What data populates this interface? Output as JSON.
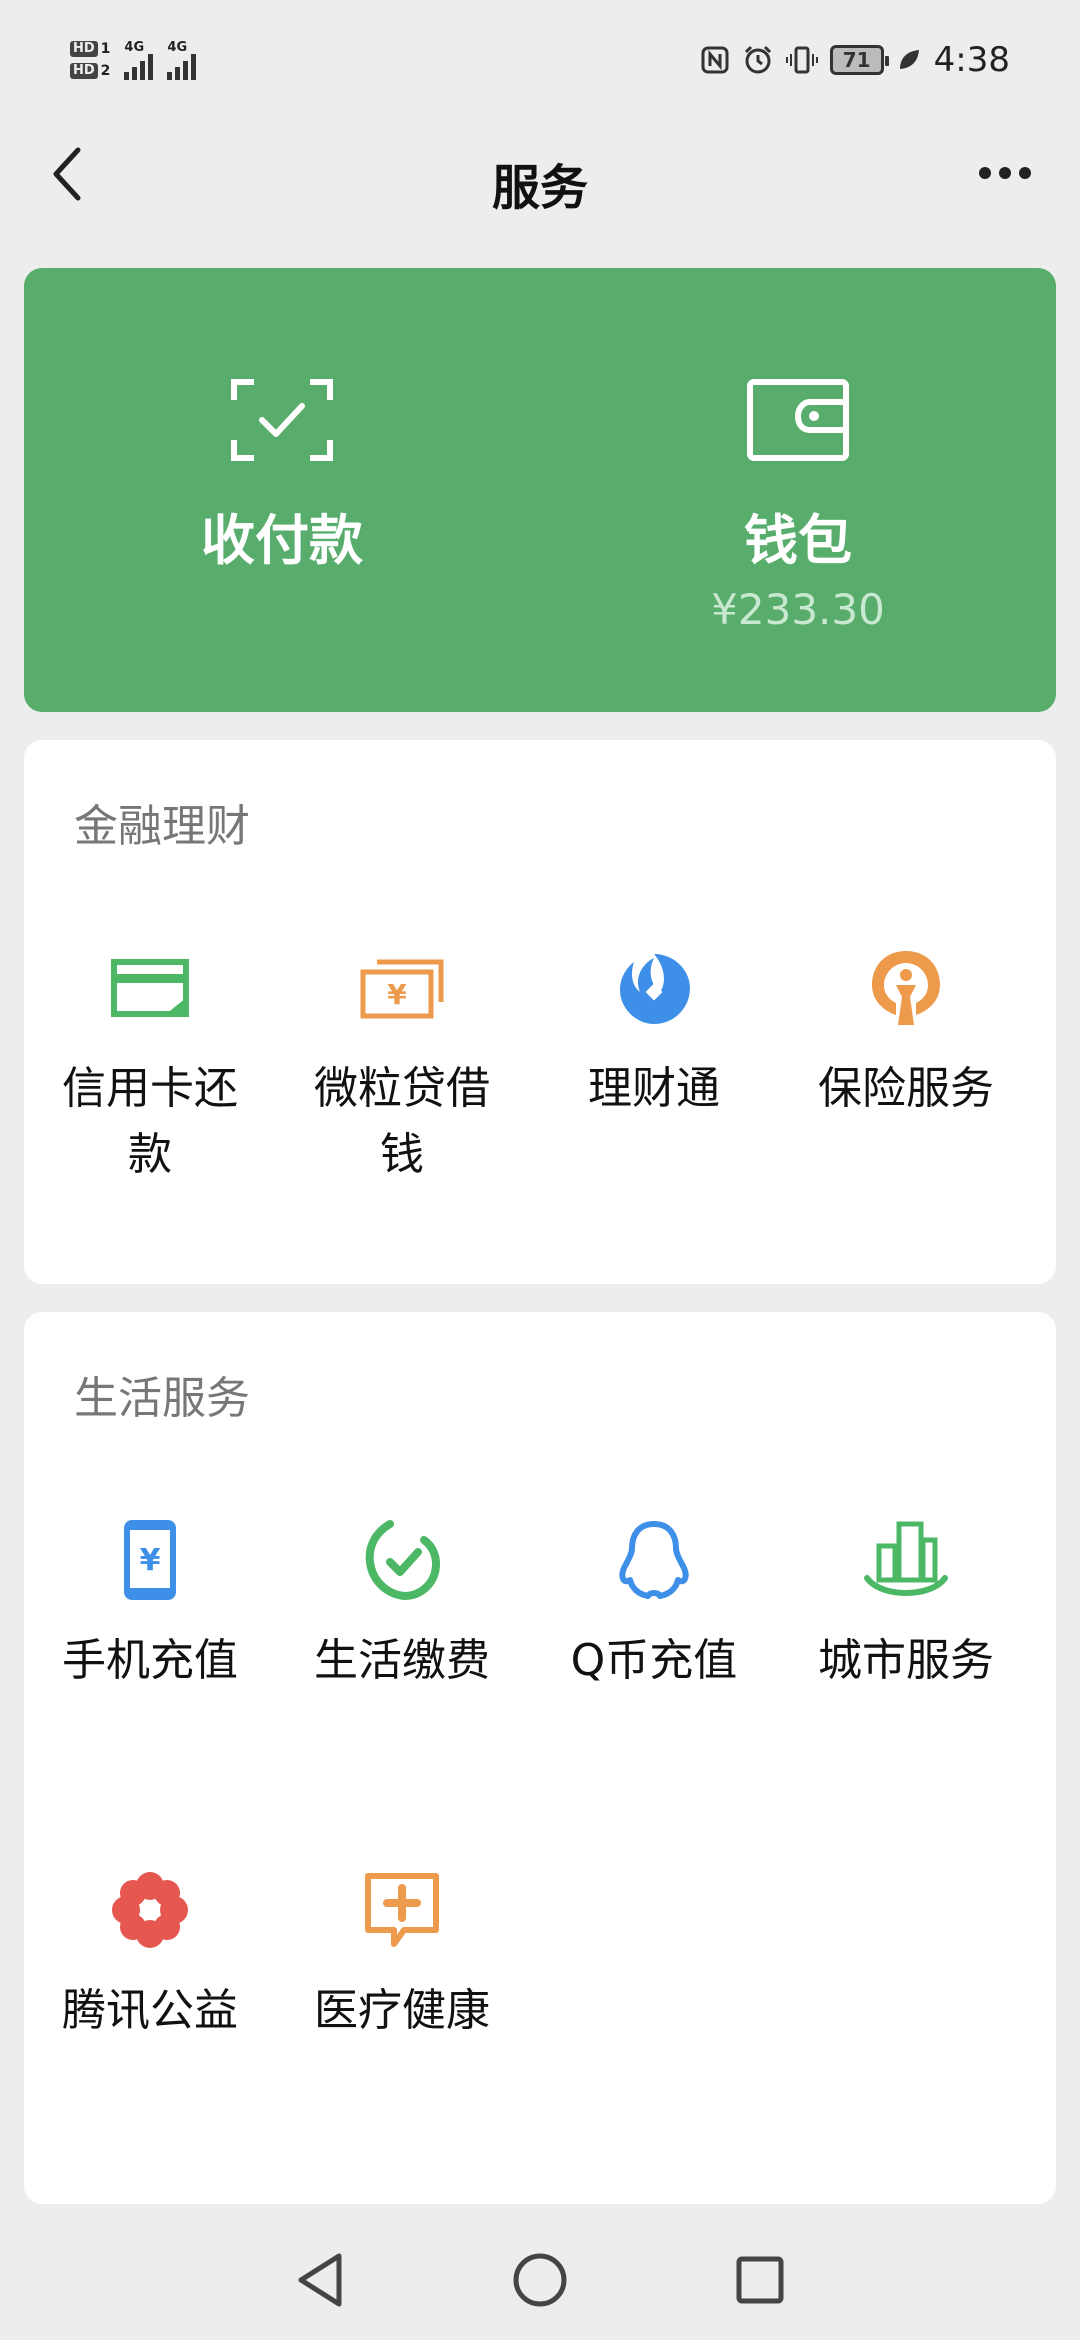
{
  "status_bar": {
    "hd1": "HD",
    "hd1_num": "1",
    "hd2": "HD",
    "hd2_num": "2",
    "sig1_label": "4G",
    "sig2_label": "4G",
    "battery": "71",
    "time": "4:38"
  },
  "header": {
    "title": "服务",
    "back_icon": "chevron-left-icon",
    "more_icon": "more-dots-icon"
  },
  "top_card": {
    "pay_label": "收付款",
    "pay_icon": "scan-check-icon",
    "wallet_label": "钱包",
    "wallet_icon": "wallet-icon",
    "wallet_balance": "¥233.30",
    "bg_color": "#58ad6c"
  },
  "finance": {
    "title": "金融理财",
    "items": [
      {
        "label": "信用卡还款",
        "icon": "credit-card-icon",
        "color": "#4cb865"
      },
      {
        "label": "微粒贷借钱",
        "icon": "loan-bills-icon",
        "color": "#ee9a4c"
      },
      {
        "label": "理财通",
        "icon": "wealth-fish-icon",
        "color": "#3d8fe8"
      },
      {
        "label": "保险服务",
        "icon": "insurance-umbrella-icon",
        "color": "#ee9a4c"
      }
    ]
  },
  "life": {
    "title": "生活服务",
    "items": [
      {
        "label": "手机充值",
        "icon": "phone-topup-icon",
        "color": "#3d8fe8"
      },
      {
        "label": "生活缴费",
        "icon": "bill-check-icon",
        "color": "#4cb865"
      },
      {
        "label": "Q币充值",
        "icon": "qq-penguin-icon",
        "color": "#3d8fe8"
      },
      {
        "label": "城市服务",
        "icon": "city-buildings-icon",
        "color": "#4cb865"
      },
      {
        "label": "腾讯公益",
        "icon": "charity-flower-icon",
        "color": "#e6574f"
      },
      {
        "label": "医疗健康",
        "icon": "medical-cross-icon",
        "color": "#ee9a4c"
      }
    ]
  },
  "system_nav": {
    "back": "triangle-back-icon",
    "home": "circle-home-icon",
    "recents": "square-recents-icon"
  }
}
